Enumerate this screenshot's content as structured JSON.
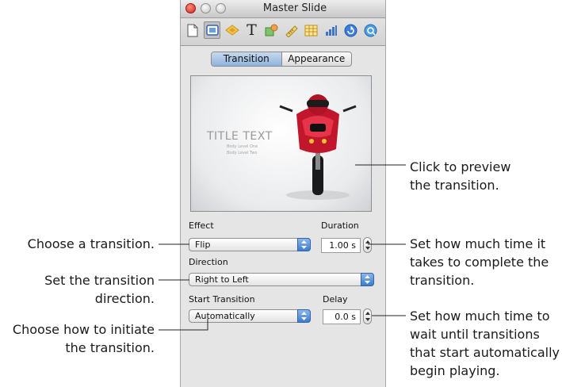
{
  "window": {
    "title": "Master Slide"
  },
  "toolbar": {
    "icons": [
      "document-icon",
      "slide-icon",
      "transition-icon",
      "text-icon",
      "graphic-icon",
      "metrics-icon",
      "table-icon",
      "chart-icon",
      "hyperlink-icon",
      "quicktime-icon"
    ]
  },
  "tabs": {
    "transition": "Transition",
    "appearance": "Appearance"
  },
  "preview": {
    "title": "TITLE TEXT",
    "body1": "Body Level One",
    "body2": "Body Level Two"
  },
  "effect": {
    "label": "Effect",
    "value": "Flip"
  },
  "duration": {
    "label": "Duration",
    "value": "1.00 s"
  },
  "direction": {
    "label": "Direction",
    "value": "Right to Left"
  },
  "start": {
    "label": "Start Transition",
    "value": "Automatically"
  },
  "delay": {
    "label": "Delay",
    "value": "0.0 s"
  },
  "callouts": {
    "preview_l1": "Click to preview",
    "preview_l2": "the transition.",
    "choose_l1": "Choose a transition.",
    "duration_l1": "Set how much time it",
    "duration_l2": "takes to complete the",
    "duration_l3": "transition.",
    "direction_l1": "Set the transition",
    "direction_l2": "direction.",
    "initiate_l1": "Choose how to initiate",
    "initiate_l2": "the transition.",
    "delay_l1": "Set how much time to",
    "delay_l2": "wait until transitions",
    "delay_l3": "that start automatically",
    "delay_l4": "begin playing."
  }
}
